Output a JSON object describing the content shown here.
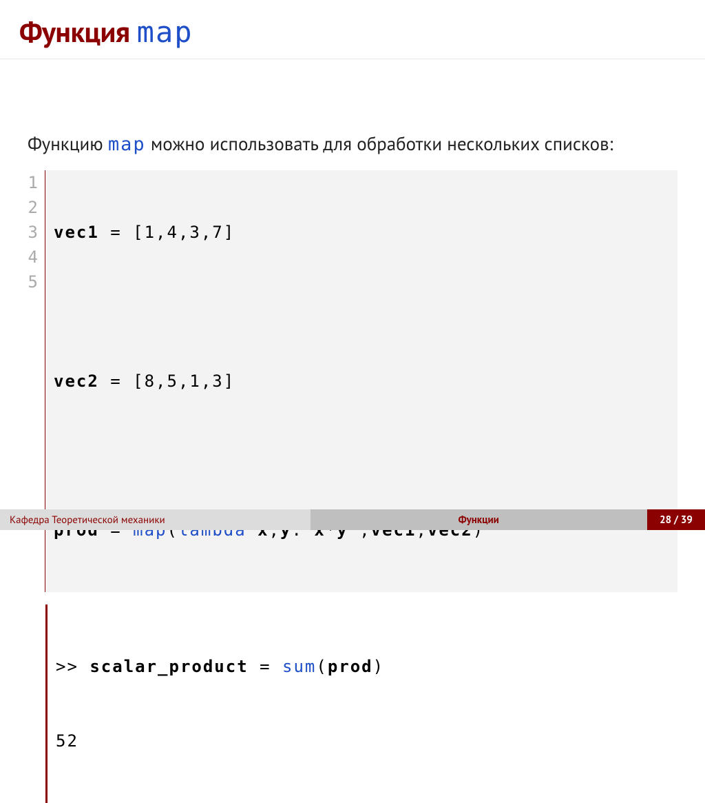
{
  "title": {
    "word": "Функция",
    "code": "map"
  },
  "intro": {
    "pre": "Функцию ",
    "code": "map",
    "post": " можно использовать для обработки нескольких списков:"
  },
  "code": {
    "gutter": [
      "1",
      "2",
      "3",
      "4",
      "5"
    ],
    "l1": {
      "a": "vec1",
      "b": " = [1,4,3,7]"
    },
    "l2": "",
    "l3": {
      "a": "vec2",
      "b": " = [8,5,1,3]"
    },
    "l4": "",
    "l5": {
      "a": "prod",
      "b": " = ",
      "c": "map",
      "d": "(",
      "e": "lambda",
      "f": " ",
      "g": "x",
      "h": ",",
      "i": "y",
      "j": ": ",
      "k": "x",
      "l": "*",
      "m": "y",
      "n": " ,",
      "o": "vec1",
      "p": ",",
      "q": "vec2",
      "r": ")"
    }
  },
  "out": {
    "l1": {
      "a": ">> ",
      "b": "scalar_product",
      "c": " = ",
      "d": "sum",
      "e": "(",
      "f": "prod",
      "g": ")"
    },
    "l2": "52"
  },
  "footer": {
    "left": "Кафедра Теоретической механики",
    "mid": "Функции",
    "right": "28 / 39"
  }
}
